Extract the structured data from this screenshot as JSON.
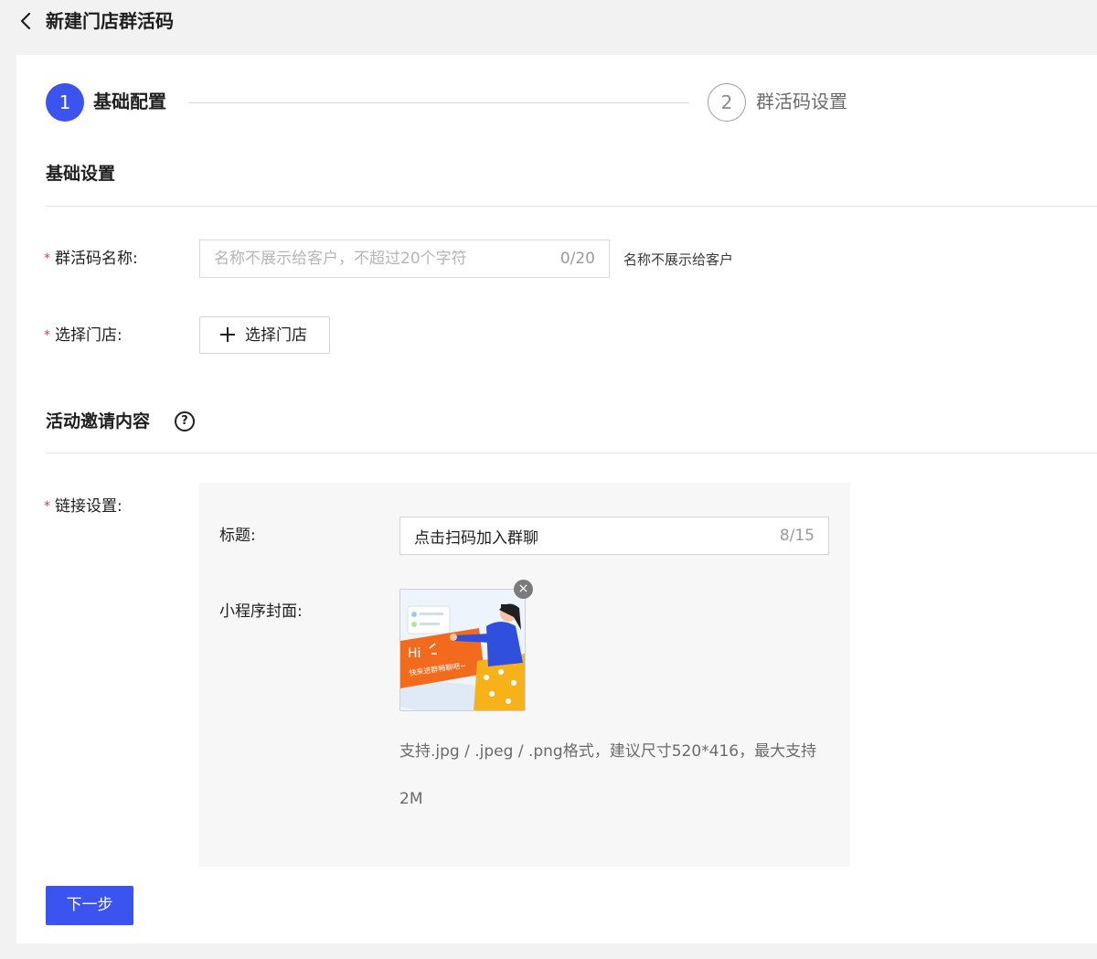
{
  "header": {
    "title": "新建门店群活码"
  },
  "steps": [
    {
      "number": "1",
      "label": "基础配置",
      "active": true
    },
    {
      "number": "2",
      "label": "群活码设置",
      "active": false
    }
  ],
  "basic_settings": {
    "section_title": "基础设置",
    "name_field": {
      "label": "群活码名称:",
      "placeholder": "名称不展示给客户，不超过20个字符",
      "value": "",
      "counter": "0/20",
      "hint": "名称不展示给客户"
    },
    "store_field": {
      "label": "选择门店:",
      "button_label": "选择门店"
    }
  },
  "invite_content": {
    "section_title": "活动邀请内容",
    "help_icon": "?",
    "link_settings": {
      "label": "链接设置:",
      "title_label": "标题:",
      "title_value": "点击扫码加入群聊",
      "title_counter": "8/15",
      "cover_label": "小程序封面:",
      "cover_image": {
        "greeting": "Hi",
        "caption": "快来进群畅聊吧~"
      },
      "remove_icon": "×",
      "upload_hint": "支持.jpg / .jpeg / .png格式，建议尺寸520*416，最大支持2M"
    }
  },
  "footer": {
    "next_button": "下一步"
  },
  "colors": {
    "primary": "#3b54f0",
    "required": "#e5383b",
    "orange": "#f26a1b",
    "yellow": "#f7b21a",
    "blue": "#2f4fdc"
  },
  "required_mark": "*"
}
